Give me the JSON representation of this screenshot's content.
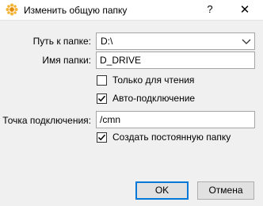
{
  "window": {
    "title": "Изменить общую папку",
    "help_label": "?",
    "close_label": "✕",
    "app_icon": "folder-icon"
  },
  "form": {
    "path_label": "Путь к папке:",
    "path_value": "D:\\",
    "name_label": "Имя папки:",
    "name_value": "D_DRIVE",
    "readonly_label": "Только для чтения",
    "readonly_checked": false,
    "automount_label": "Авто-подключение",
    "automount_checked": true,
    "mountpoint_label": "Точка подключения:",
    "mountpoint_value": "/cmn",
    "permanent_label": "Создать постоянную папку",
    "permanent_checked": true
  },
  "buttons": {
    "ok_label": "OK",
    "cancel_label": "Отмена"
  }
}
